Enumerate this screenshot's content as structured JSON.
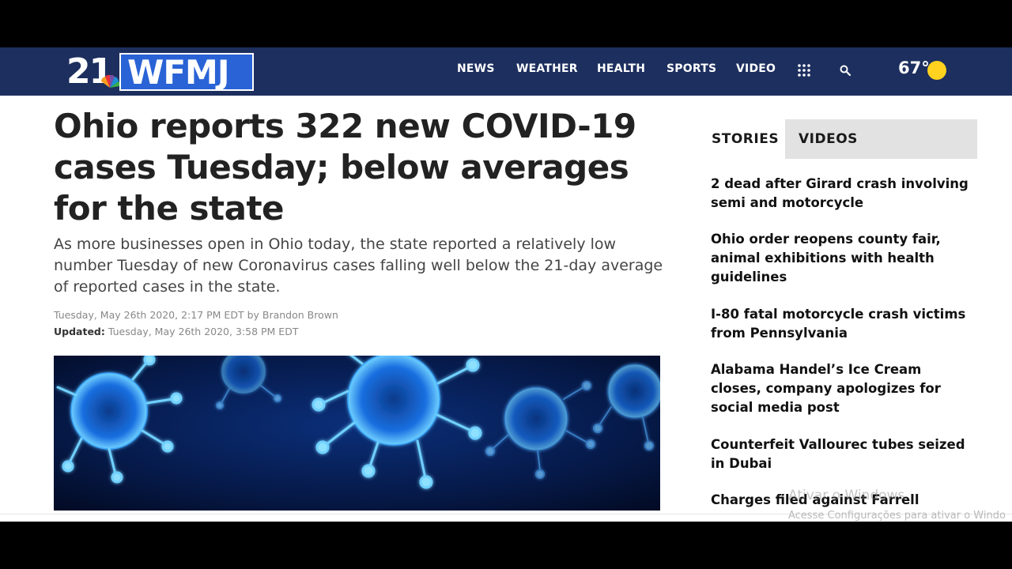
{
  "brand": {
    "channel_number": "21",
    "name": "WFMJ"
  },
  "nav": {
    "items": [
      "NEWS",
      "WEATHER",
      "HEALTH",
      "SPORTS",
      "VIDEO"
    ],
    "menu_icon": "grid-icon",
    "search_icon": "search-icon",
    "weather": {
      "temperature": "67°",
      "icon": "sun-icon",
      "color": "#ffd21f"
    },
    "background": "#1d2f5e"
  },
  "article": {
    "headline": "Ohio reports 322 new COVID-19 cases Tuesday; below averages for the state",
    "deck": "As more businesses open in Ohio today, the state reported a relatively low number Tuesday of new Coronavirus cases falling well below the 21-day average of reported cases in the state.",
    "published": "Tuesday, May 26th 2020, 2:17 PM EDT",
    "byline": "by Brandon Brown",
    "updated_label": "Updated:",
    "updated": "Tuesday, May 26th 2020, 3:58 PM EDT",
    "hero_image": "coronavirus-particles"
  },
  "sidebar": {
    "tabs": [
      "STORIES",
      "VIDEOS"
    ],
    "stories": [
      "2 dead after Girard crash involving semi and motorcycle",
      "Ohio order reopens county fair, animal exhibitions with health guidelines",
      "I-80 fatal motorcycle crash victims from Pennsylvania",
      "Alabama Handel’s Ice Cream closes, company apologizes for social media post",
      "Counterfeit Vallourec tubes seized in Dubai",
      "Charges filed against Farrell"
    ]
  },
  "watermark": {
    "line1": "Ativar o Windows",
    "line2": "Acesse Configurações para ativar o Windo"
  }
}
